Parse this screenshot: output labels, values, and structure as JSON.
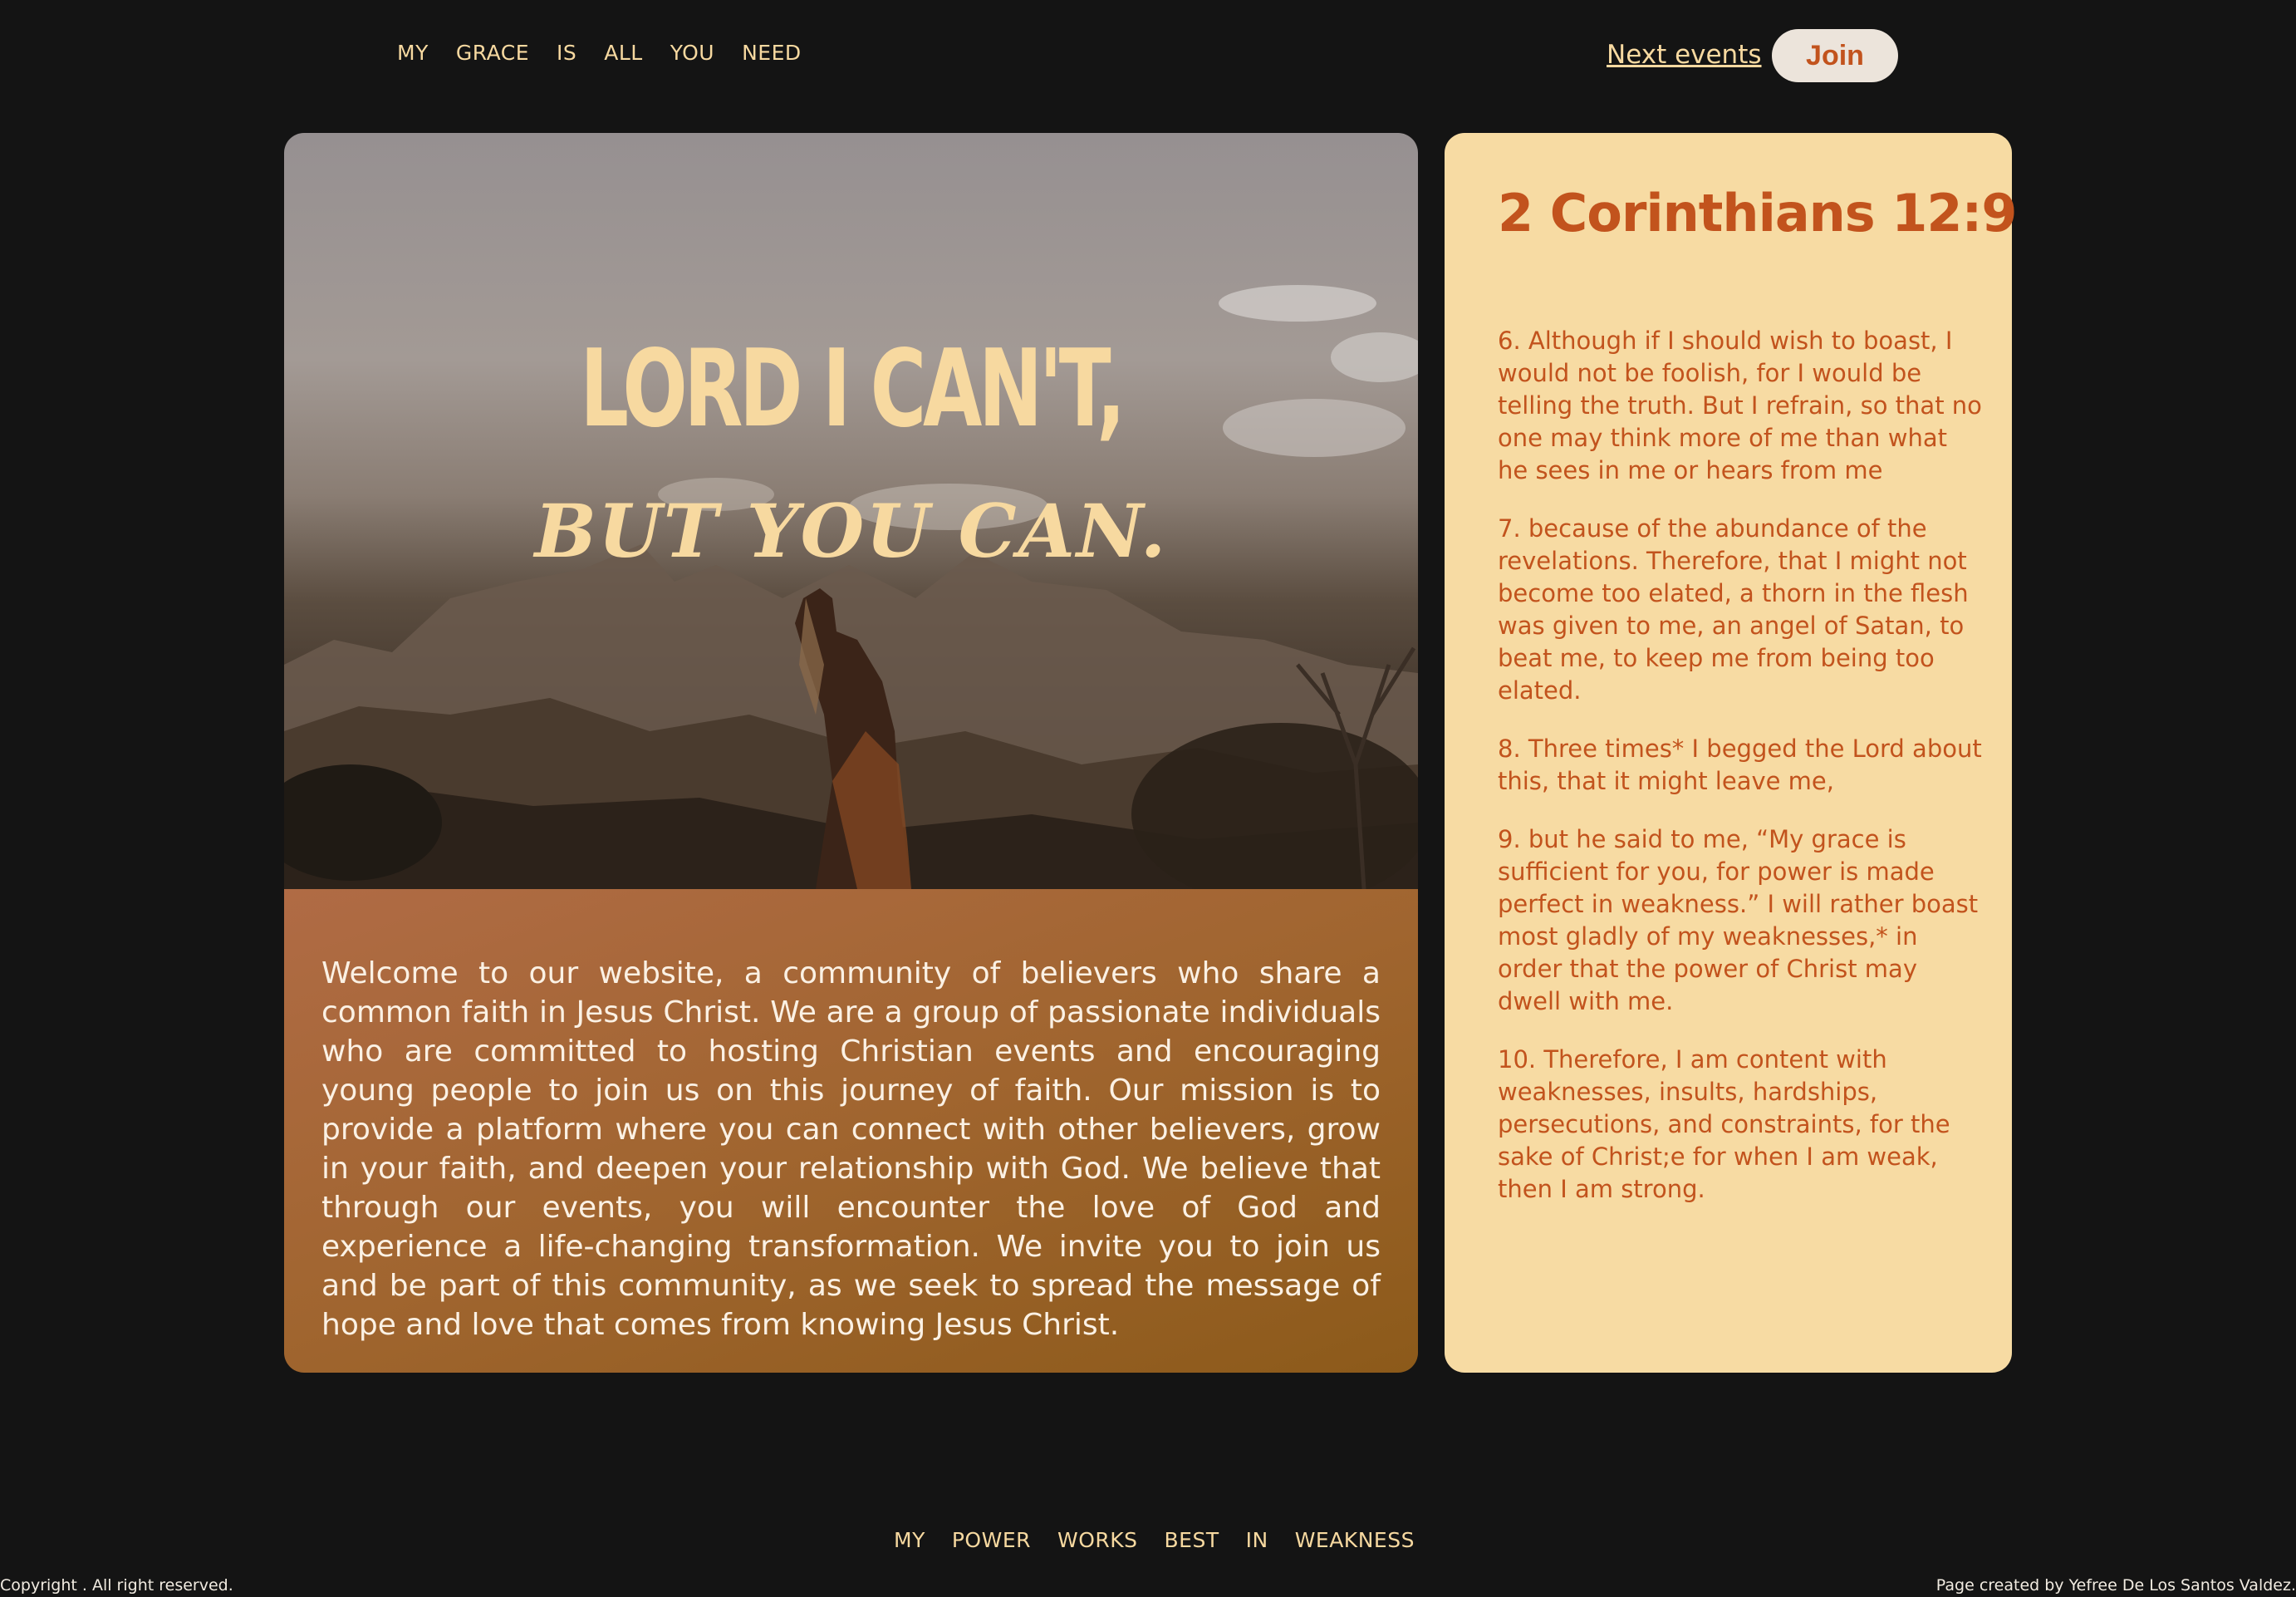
{
  "header": {
    "nav": [
      "MY",
      "GRACE",
      "IS",
      "ALL",
      "YOU",
      "NEED"
    ],
    "next_events": "Next events",
    "join": "Join"
  },
  "hero": {
    "title": "LORD I CAN'T,",
    "subtitle": "BUT YOU CAN."
  },
  "welcome": {
    "text": "Welcome to our website, a community of believers who share a common faith in Jesus Christ. We are a group of passionate individuals who are committed to hosting Christian events and encouraging young people to join us on this journey of faith. Our mission is to provide a platform where you can connect with other believers, grow in your faith, and deepen your relationship with God. We believe that through our events, you will encounter the love of God and experience a life-changing transformation. We invite you to join us and be part of this community, as we seek to spread the message of hope and love that comes from knowing Jesus Christ."
  },
  "scripture": {
    "title": "2 Corinthians 12:9",
    "verses": [
      "6. Although if I should wish to boast, I would not be foolish, for I would be telling the truth. But I refrain, so that no one may think more of me than what he sees in me or hears from me",
      "7. because of the abundance of the revelations. Therefore, that I might not become too elated, a thorn in the flesh was given to me, an angel of Satan, to beat me, to keep me from being too elated.",
      "8. Three times* I begged the Lord about this, that it might leave me,",
      "9. but he said to me, “My grace is sufficient for you, for power is made perfect in weakness.” I will rather boast most gladly of my weaknesses,* in order that the power of Christ may dwell with me.",
      "10. Therefore, I am content with weaknesses, insults, hardships, persecutions, and constraints, for the sake of Christ;e for when I am weak, then I am strong."
    ]
  },
  "footer": {
    "nav": [
      "MY",
      "POWER",
      "WORKS",
      "BEST",
      "IN",
      "WEAKNESS"
    ],
    "copyright": "Copyright . All right reserved.",
    "credit": "Page created by Yefree De Los Santos Valdez."
  },
  "colors": {
    "background": "#141414",
    "accent": "#f7d9a0",
    "scripture_text": "#c2531d",
    "scripture_bg": "#f7dba3"
  }
}
